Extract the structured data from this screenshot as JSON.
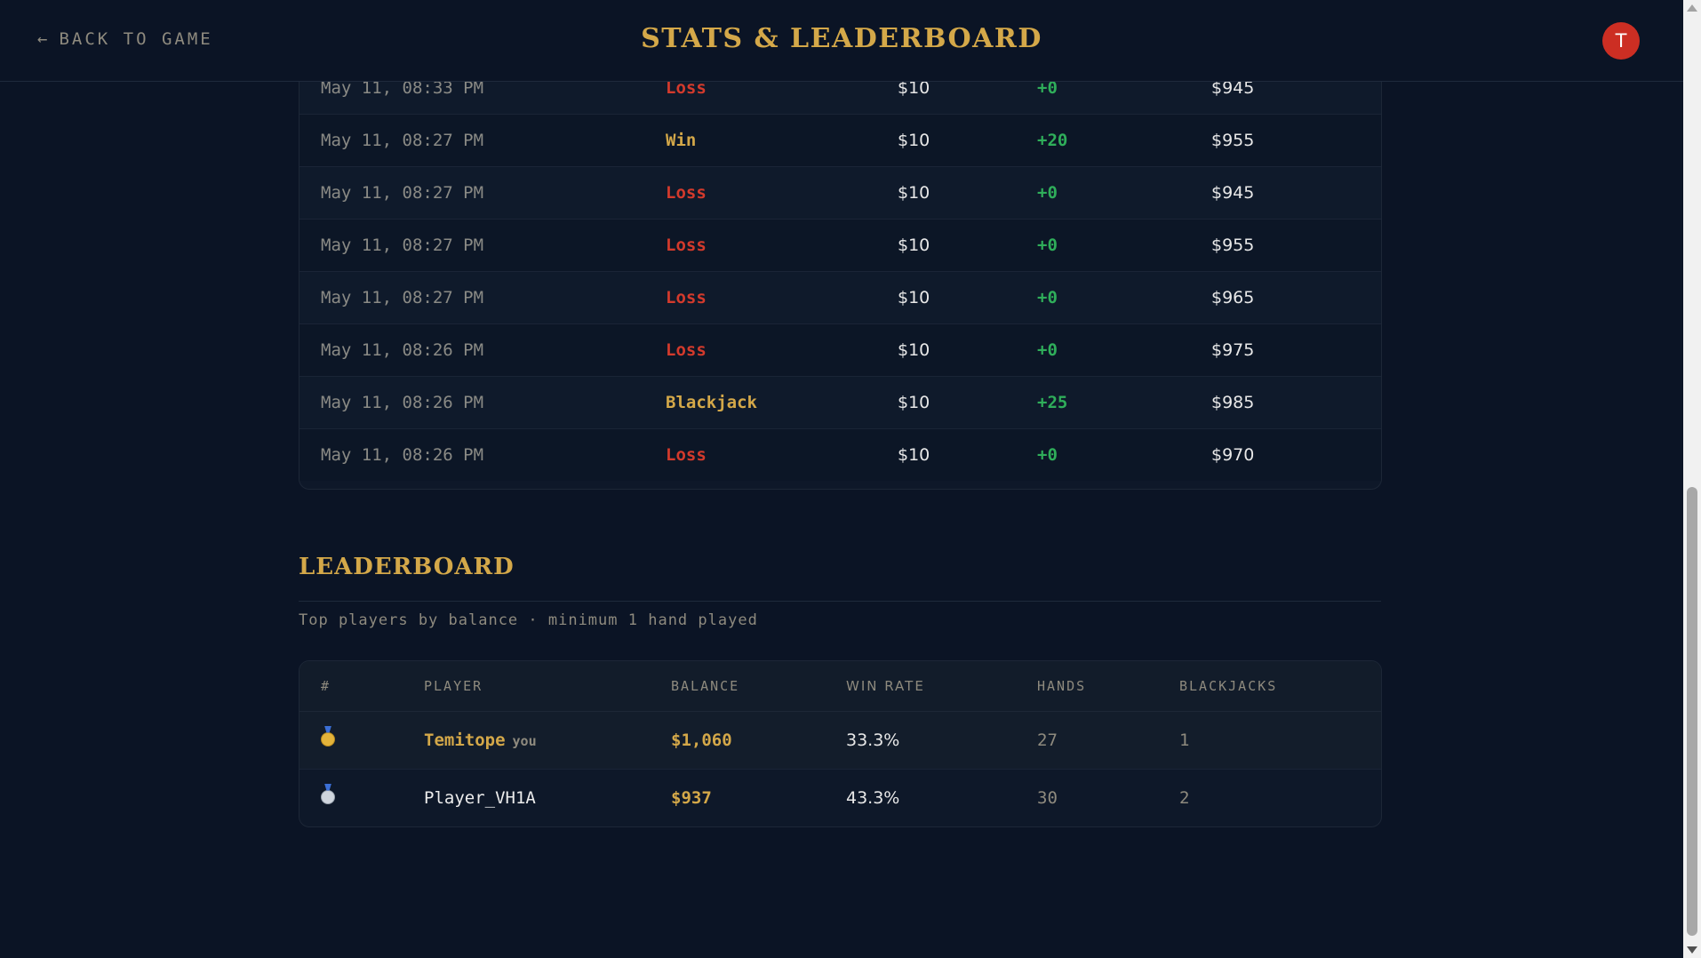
{
  "header": {
    "back_arrow": "←",
    "back_label": "BACK TO GAME",
    "title": "STATS & LEADERBOARD",
    "avatar_initial": "T"
  },
  "history": {
    "rows": [
      {
        "date": "May 11, 08:33 PM",
        "result": "Loss",
        "bet": "$10",
        "net": "+0",
        "balance": "$945"
      },
      {
        "date": "May 11, 08:27 PM",
        "result": "Win",
        "bet": "$10",
        "net": "+20",
        "balance": "$955"
      },
      {
        "date": "May 11, 08:27 PM",
        "result": "Loss",
        "bet": "$10",
        "net": "+0",
        "balance": "$945"
      },
      {
        "date": "May 11, 08:27 PM",
        "result": "Loss",
        "bet": "$10",
        "net": "+0",
        "balance": "$955"
      },
      {
        "date": "May 11, 08:27 PM",
        "result": "Loss",
        "bet": "$10",
        "net": "+0",
        "balance": "$965"
      },
      {
        "date": "May 11, 08:26 PM",
        "result": "Loss",
        "bet": "$10",
        "net": "+0",
        "balance": "$975"
      },
      {
        "date": "May 11, 08:26 PM",
        "result": "Blackjack",
        "bet": "$10",
        "net": "+25",
        "balance": "$985"
      },
      {
        "date": "May 11, 08:26 PM",
        "result": "Loss",
        "bet": "$10",
        "net": "+0",
        "balance": "$970"
      }
    ]
  },
  "leaderboard": {
    "heading": "LEADERBOARD",
    "subtitle": "Top players by balance · minimum 1 hand played",
    "columns": {
      "rank": "#",
      "player": "PLAYER",
      "balance": "BALANCE",
      "win_rate": "WIN RATE",
      "hands": "HANDS",
      "blackjacks": "BLACKJACKS"
    },
    "rows": [
      {
        "medal": "gold-medal-icon",
        "player": "Temitope",
        "you_tag": "you",
        "balance": "$1,060",
        "win_rate": "33.3%",
        "hands": "27",
        "blackjacks": "1"
      },
      {
        "medal": "silver-medal-icon",
        "player": "Player_VH1A",
        "you_tag": "",
        "balance": "$937",
        "win_rate": "43.3%",
        "hands": "30",
        "blackjacks": "2"
      }
    ]
  },
  "colors": {
    "background": "#0b1425",
    "gold_accent": "#d4a849",
    "loss_red": "#d33a2c",
    "net_green": "#2fae5a",
    "avatar_red": "#cc2e23"
  }
}
